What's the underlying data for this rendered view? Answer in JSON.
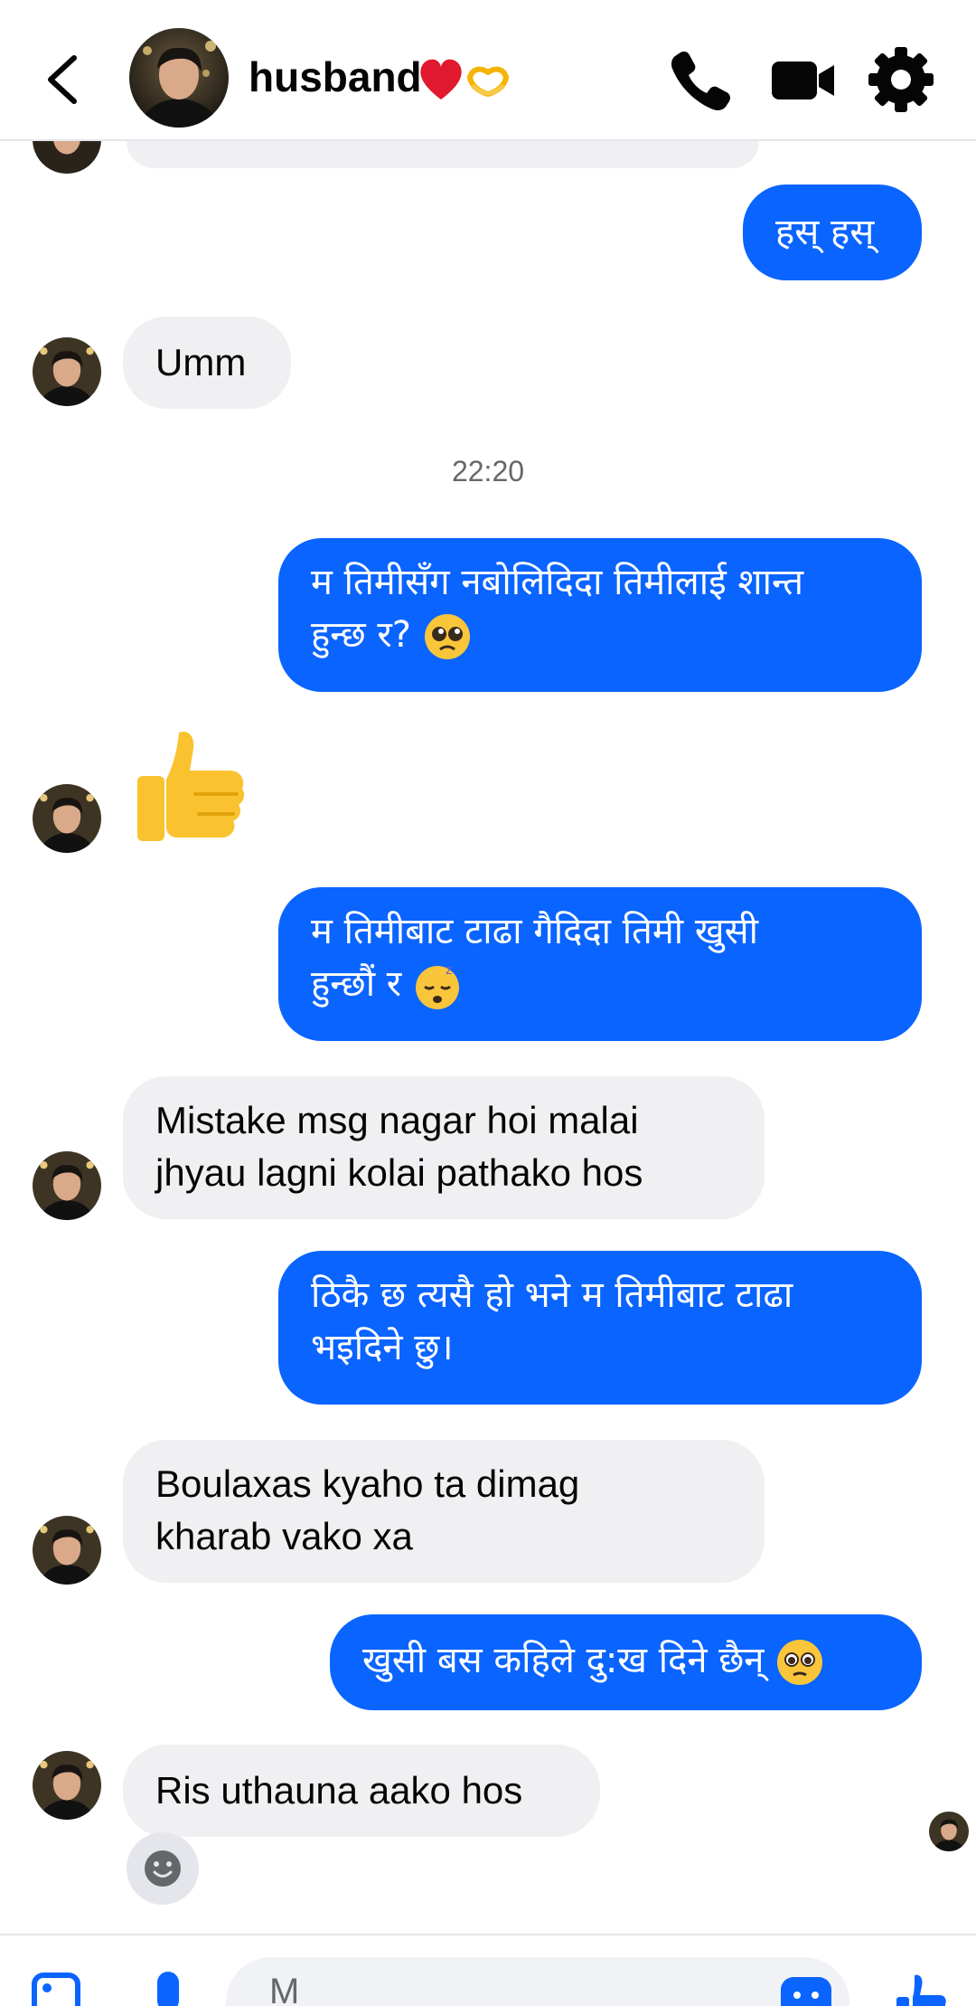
{
  "header": {
    "contact_name": "husband",
    "title_emoji": "❤️🫶"
  },
  "timestamp": "22:20",
  "messages": [
    {
      "direction": "out",
      "text": "हस् हस्"
    },
    {
      "direction": "in",
      "text": "Umm"
    },
    {
      "direction": "out",
      "text_line1": "म तिमीसँग नबोलिदिदा तिमीलाई शान्त",
      "text_line2": "हुन्छ र?",
      "emoji": "pleading-face"
    },
    {
      "direction": "in",
      "emoji": "thumbs-up"
    },
    {
      "direction": "out",
      "text_line1": "म तिमीबाट टाढा गैदिदा तिमी खुसी",
      "text_line2": "हुन्छौं र",
      "emoji": "sleepy-face"
    },
    {
      "direction": "in",
      "text_line1": "Mistake msg nagar hoi malai",
      "text_line2": "jhyau lagni kolai pathako hos"
    },
    {
      "direction": "out",
      "text_line1": "ठिकै छ त्यसै हो भने म तिमीबाट टाढा",
      "text_line2": "भइदिने छु।"
    },
    {
      "direction": "in",
      "text_line1": "Boulaxas kyaho ta dimag",
      "text_line2": "kharab vako xa"
    },
    {
      "direction": "out",
      "text": "खुसी बस कहिले दु:ख दिने छैन्",
      "emoji": "holding-back-tears-face"
    },
    {
      "direction": "in",
      "text": "Ris uthauna aako hos"
    }
  ],
  "composer": {
    "placeholder": "M"
  },
  "colors": {
    "outgoing_bubble": "#0a64ff",
    "incoming_bubble": "#f0f0f2",
    "accent": "#0a64ff",
    "header_icon": "#050505"
  }
}
